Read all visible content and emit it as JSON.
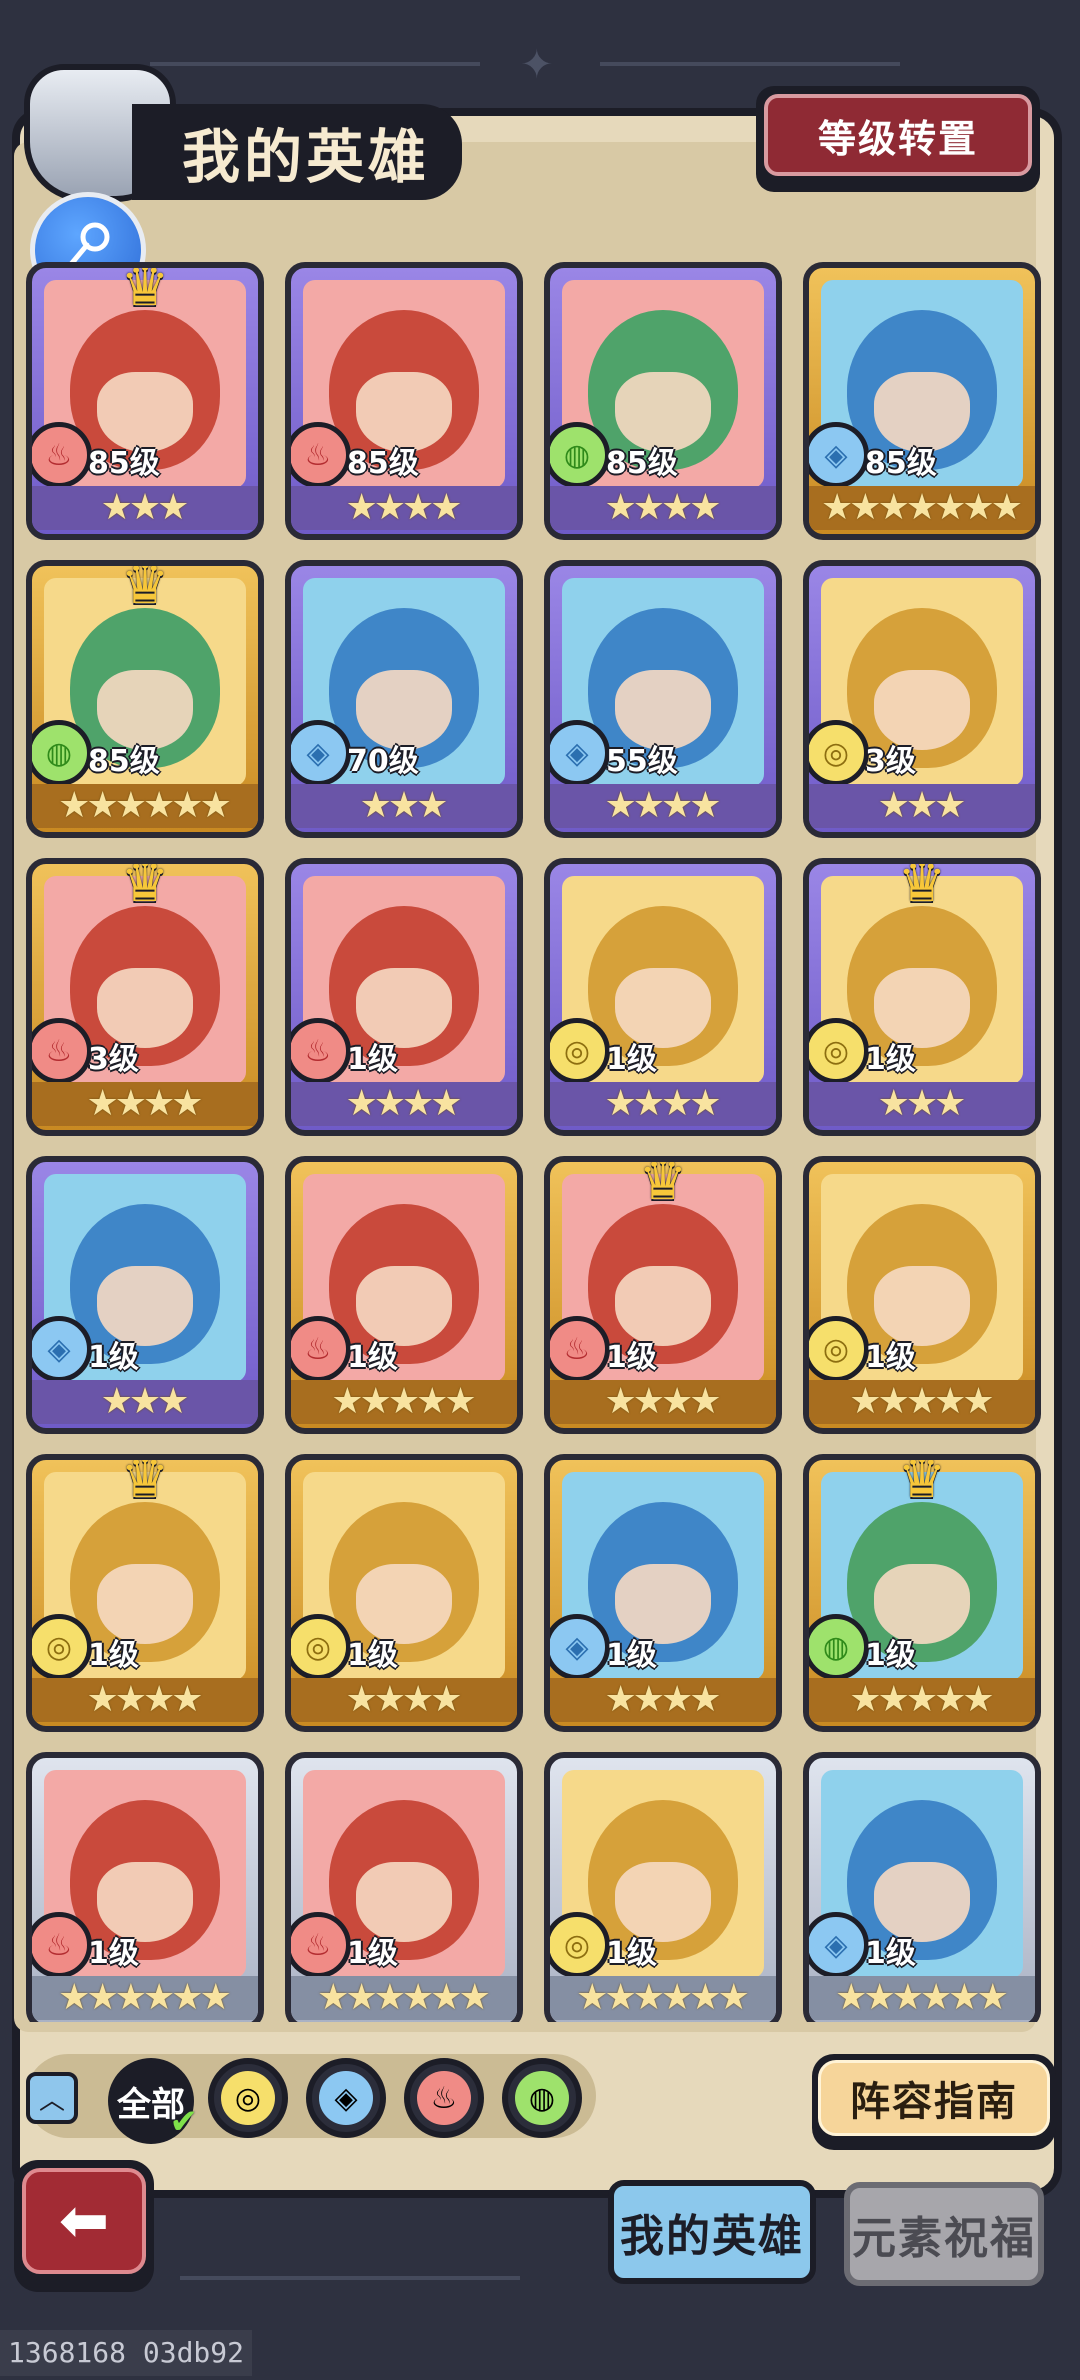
{
  "header": {
    "title": "我的英雄",
    "transfer_label": "等级转置"
  },
  "heroes": [
    {
      "level": "85级",
      "element": "fire",
      "stars": 3,
      "frame": "purple",
      "crown": true,
      "bg": "pink"
    },
    {
      "level": "85级",
      "element": "fire",
      "stars": 4,
      "frame": "purple",
      "crown": false,
      "bg": "pink"
    },
    {
      "level": "85级",
      "element": "wind",
      "stars": 4,
      "frame": "purple",
      "crown": false,
      "bg": "pink"
    },
    {
      "level": "85级",
      "element": "water",
      "stars": 7,
      "frame": "gold",
      "crown": false,
      "bg": "blue"
    },
    {
      "level": "85级",
      "element": "wind",
      "stars": 6,
      "frame": "gold",
      "crown": true,
      "bg": "yellow"
    },
    {
      "level": "70级",
      "element": "water",
      "stars": 3,
      "frame": "purple",
      "crown": false,
      "bg": "blue"
    },
    {
      "level": "55级",
      "element": "water",
      "stars": 4,
      "frame": "purple",
      "crown": false,
      "bg": "blue"
    },
    {
      "level": "3级",
      "element": "earth",
      "stars": 3,
      "frame": "purple",
      "crown": false,
      "bg": "yellow"
    },
    {
      "level": "3级",
      "element": "fire",
      "stars": 4,
      "frame": "gold",
      "crown": true,
      "bg": "pink"
    },
    {
      "level": "1级",
      "element": "fire",
      "stars": 4,
      "frame": "purple",
      "crown": false,
      "bg": "pink"
    },
    {
      "level": "1级",
      "element": "earth",
      "stars": 4,
      "frame": "purple",
      "crown": false,
      "bg": "yellow"
    },
    {
      "level": "1级",
      "element": "earth",
      "stars": 3,
      "frame": "purple",
      "crown": true,
      "bg": "yellow"
    },
    {
      "level": "1级",
      "element": "water",
      "stars": 3,
      "frame": "purple",
      "crown": false,
      "bg": "blue"
    },
    {
      "level": "1级",
      "element": "fire",
      "stars": 5,
      "frame": "gold",
      "crown": false,
      "bg": "pink"
    },
    {
      "level": "1级",
      "element": "fire",
      "stars": 4,
      "frame": "gold",
      "crown": true,
      "bg": "pink"
    },
    {
      "level": "1级",
      "element": "earth",
      "stars": 5,
      "frame": "gold",
      "crown": false,
      "bg": "yellow"
    },
    {
      "level": "1级",
      "element": "earth",
      "stars": 4,
      "frame": "gold",
      "crown": true,
      "bg": "yellow"
    },
    {
      "level": "1级",
      "element": "earth",
      "stars": 4,
      "frame": "gold",
      "crown": false,
      "bg": "yellow"
    },
    {
      "level": "1级",
      "element": "water",
      "stars": 4,
      "frame": "gold",
      "crown": false,
      "bg": "blue"
    },
    {
      "level": "1级",
      "element": "wind",
      "stars": 5,
      "frame": "gold",
      "crown": true,
      "bg": "blue"
    },
    {
      "level": "1级",
      "element": "fire",
      "stars": 6,
      "frame": "silver",
      "crown": false,
      "bg": "pink"
    },
    {
      "level": "1级",
      "element": "fire",
      "stars": 6,
      "frame": "silver",
      "crown": false,
      "bg": "pink"
    },
    {
      "level": "1级",
      "element": "earth",
      "stars": 6,
      "frame": "silver",
      "crown": false,
      "bg": "yellow"
    },
    {
      "level": "1级",
      "element": "water",
      "stars": 6,
      "frame": "silver",
      "crown": false,
      "bg": "blue"
    }
  ],
  "filters": {
    "all_label": "全部",
    "elements": [
      "earth",
      "water",
      "fire",
      "wind"
    ]
  },
  "guide_label": "阵容指南",
  "tabs": {
    "my_heroes": "我的英雄",
    "element_blessing": "元素祝福"
  },
  "watermark": "1368168 03db92",
  "colors": {
    "fire": "#f08b86",
    "water": "#8cc8f2",
    "earth": "#f6df6b",
    "wind": "#9ee26c",
    "frame_purple": "#7a64d2",
    "frame_gold": "#e3a83a",
    "frame_silver": "#c5ccd9"
  },
  "icons": {
    "fire": "flame-icon",
    "water": "droplet-icon",
    "earth": "earth-swirl-icon",
    "wind": "wind-swirl-icon",
    "back": "back-arrow-icon",
    "key": "key-icon",
    "collapse": "chevron-up-icon"
  }
}
